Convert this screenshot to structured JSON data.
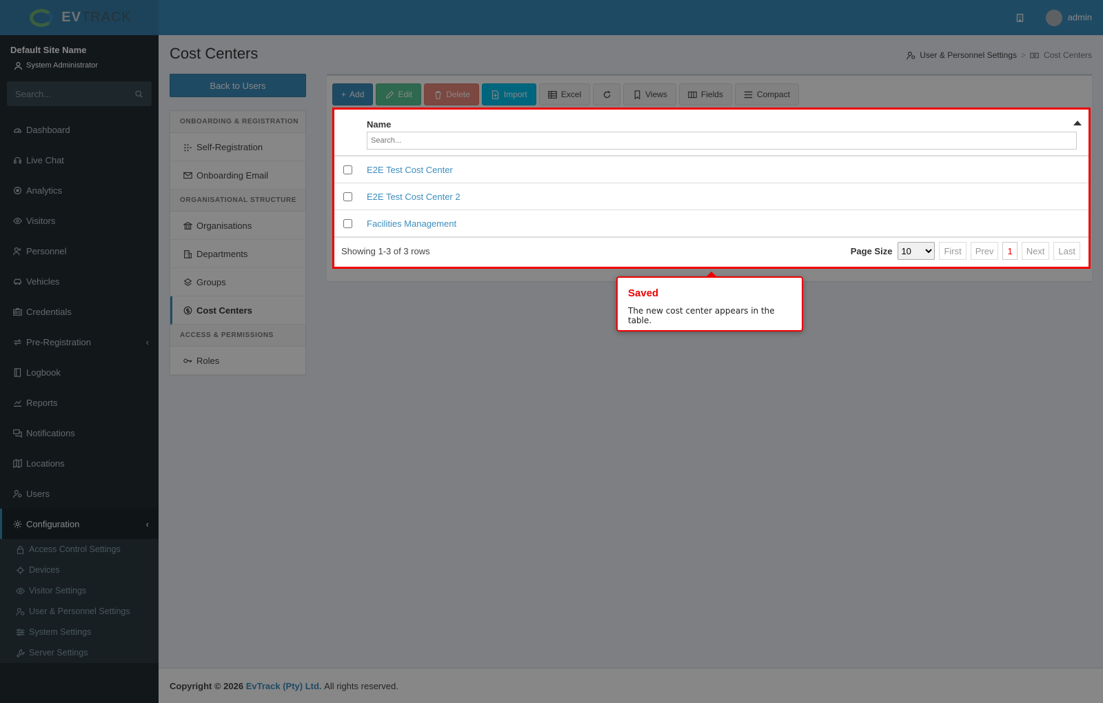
{
  "brand": {
    "logo_bold": "EV",
    "logo_light": "TRACK"
  },
  "topbar": {
    "username": "admin"
  },
  "sidebar": {
    "site_name": "Default Site Name",
    "role": "System Administrator",
    "search_placeholder": "Search...",
    "items": [
      {
        "label": "Dashboard",
        "icon": "dashboard-icon"
      },
      {
        "label": "Live Chat",
        "icon": "headset-icon"
      },
      {
        "label": "Analytics",
        "icon": "target-icon"
      },
      {
        "label": "Visitors",
        "icon": "eye-icon"
      },
      {
        "label": "Personnel",
        "icon": "person-add-icon"
      },
      {
        "label": "Vehicles",
        "icon": "car-icon"
      },
      {
        "label": "Credentials",
        "icon": "id-card-icon"
      },
      {
        "label": "Pre-Registration",
        "icon": "arrows-icon"
      },
      {
        "label": "Logbook",
        "icon": "book-icon"
      },
      {
        "label": "Reports",
        "icon": "chart-icon"
      },
      {
        "label": "Notifications",
        "icon": "chat-icon"
      },
      {
        "label": "Locations",
        "icon": "map-icon"
      },
      {
        "label": "Users",
        "icon": "users-icon"
      },
      {
        "label": "Configuration",
        "icon": "gear-icon"
      }
    ],
    "submenu": [
      {
        "label": "Access Control Settings",
        "icon": "lock-icon"
      },
      {
        "label": "Devices",
        "icon": "chip-icon"
      },
      {
        "label": "Visitor Settings",
        "icon": "eye-icon"
      },
      {
        "label": "User & Personnel Settings",
        "icon": "users-icon"
      },
      {
        "label": "System Settings",
        "icon": "sliders-icon"
      },
      {
        "label": "Server Settings",
        "icon": "wrench-icon"
      }
    ]
  },
  "page": {
    "title": "Cost Centers",
    "breadcrumb": [
      "User & Personnel Settings",
      "Cost Centers"
    ],
    "back_label": "Back to Users"
  },
  "left_nav": {
    "sections": [
      {
        "heading": "ONBOARDING & REGISTRATION",
        "items": [
          "Self-Registration",
          "Onboarding Email"
        ]
      },
      {
        "heading": "ORGANISATIONAL STRUCTURE",
        "items": [
          "Organisations",
          "Departments",
          "Groups",
          "Cost Centers"
        ]
      },
      {
        "heading": "ACCESS & PERMISSIONS",
        "items": [
          "Roles"
        ]
      }
    ]
  },
  "toolbar": {
    "add": "Add",
    "edit": "Edit",
    "delete": "Delete",
    "import": "Import",
    "excel": "Excel",
    "views": "Views",
    "fields": "Fields",
    "compact": "Compact"
  },
  "table": {
    "column": "Name",
    "search_placeholder": "Search...",
    "rows": [
      "E2E Test Cost Center",
      "E2E Test Cost Center 2",
      "Facilities Management"
    ],
    "showing": "Showing 1-3 of 3 rows",
    "page_size_label": "Page Size",
    "page_size": "10",
    "pager": {
      "first": "First",
      "prev": "Prev",
      "current": "1",
      "next": "Next",
      "last": "Last"
    }
  },
  "popover": {
    "title": "Saved",
    "text": "The new cost center appears in the table."
  },
  "footer": {
    "prefix": "Copyright © 2026",
    "company": "EvTrack (Pty) Ltd.",
    "suffix": "All rights reserved."
  }
}
